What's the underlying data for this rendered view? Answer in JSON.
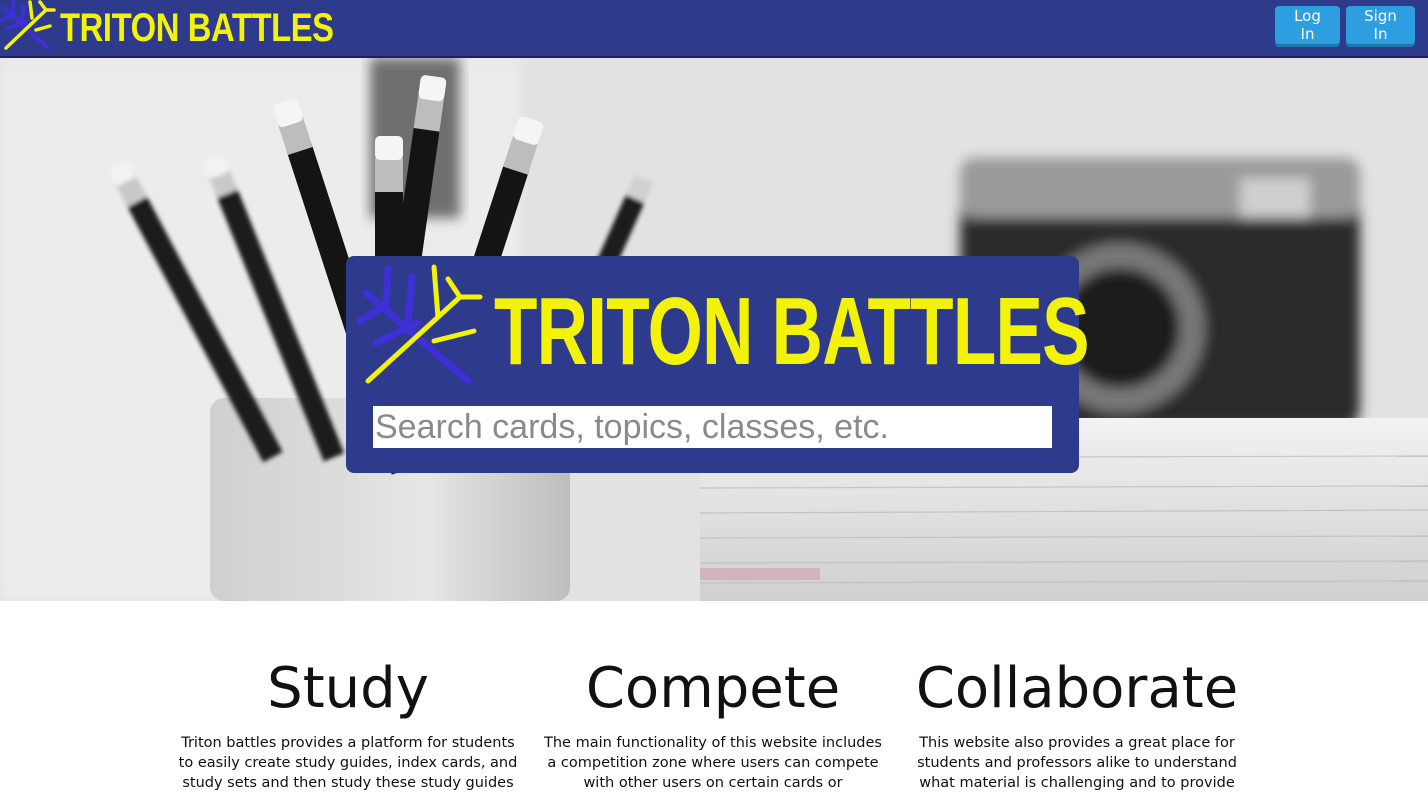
{
  "header": {
    "brand": "TRITON BATTLES",
    "login_label": "Log In",
    "signin_label": "Sign In"
  },
  "hero": {
    "brand": "TRITON BATTLES",
    "search_placeholder": "Search cards, topics, classes, etc."
  },
  "features": [
    {
      "title": "Study",
      "text": "Triton battles provides a platform for students to easily create study guides, index cards, and study sets and then study these study guides"
    },
    {
      "title": "Compete",
      "text": "The main functionality of this website includes a competition zone where users can compete with other users on certain cards or"
    },
    {
      "title": "Collaborate",
      "text": "This website also provides a great place for students and professors alike to understand what material is challenging and to provide"
    }
  ],
  "colors": {
    "brand_blue": "#2e3a8c",
    "brand_yellow": "#f2f20a",
    "button_blue": "#2d9ee0"
  },
  "icons": {
    "logo": "trident-icon"
  }
}
